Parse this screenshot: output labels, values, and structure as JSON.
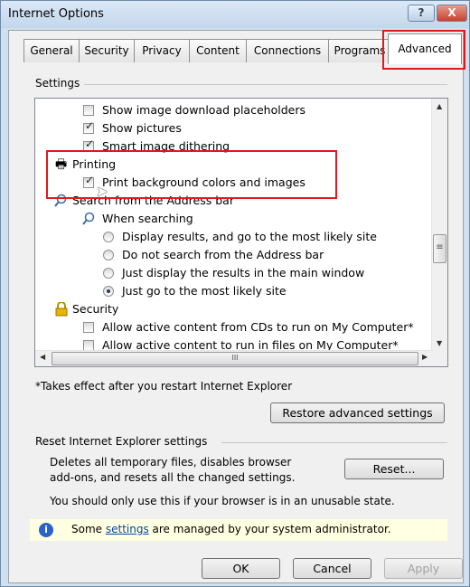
{
  "window": {
    "title": "Internet Options",
    "help_label": "?",
    "close_label": "X"
  },
  "tabs": [
    {
      "label": "General"
    },
    {
      "label": "Security"
    },
    {
      "label": "Privacy"
    },
    {
      "label": "Content"
    },
    {
      "label": "Connections"
    },
    {
      "label": "Programs"
    },
    {
      "label": "Advanced"
    }
  ],
  "settings": {
    "group_label": "Settings",
    "items": [
      {
        "type": "checkbox",
        "label": "Show image download placeholders",
        "checked": false
      },
      {
        "type": "checkbox",
        "label": "Show pictures",
        "checked": true
      },
      {
        "type": "checkbox",
        "label": "Smart image dithering",
        "checked": true
      },
      {
        "type": "category",
        "label": "Printing",
        "icon": "printer-icon"
      },
      {
        "type": "checkbox",
        "label": "Print background colors and images",
        "checked": true
      },
      {
        "type": "category",
        "label": "Search from the Address bar",
        "icon": "magnifier-icon"
      },
      {
        "type": "subcategory",
        "label": "When searching",
        "icon": "magnifier-icon"
      },
      {
        "type": "radio",
        "label": "Display results, and go to the most likely site",
        "checked": false
      },
      {
        "type": "radio",
        "label": "Do not search from the Address bar",
        "checked": false
      },
      {
        "type": "radio",
        "label": "Just display the results in the main window",
        "checked": false
      },
      {
        "type": "radio",
        "label": "Just go to the most likely site",
        "checked": true
      },
      {
        "type": "category",
        "label": "Security",
        "icon": "lock-icon"
      },
      {
        "type": "checkbox",
        "label": "Allow active content from CDs to run on My Computer*",
        "checked": false
      },
      {
        "type": "checkbox",
        "label": "Allow active content to run in files on My Computer*",
        "checked": false
      }
    ],
    "scrollbar_grip": "≡",
    "hscroll_grip": "III"
  },
  "restart_note": "*Takes effect after you restart Internet Explorer",
  "restore_button": "Restore advanced settings",
  "reset_group": {
    "label": "Reset Internet Explorer settings",
    "description_line1": "Deletes all temporary files, disables browser",
    "description_line2": "add-ons, and resets all the changed settings.",
    "reset_button": "Reset...",
    "warning": "You should only use this if your browser is in an unusable state."
  },
  "info_bar": {
    "text_before": "Some ",
    "link": "settings",
    "text_after": " are managed by your system administrator."
  },
  "buttons": {
    "ok": "OK",
    "cancel": "Cancel",
    "apply": "Apply"
  },
  "colors": {
    "highlight_box": "#e5161e",
    "info_bg": "#ffffe1",
    "title_bg": "#cfe0f1"
  }
}
